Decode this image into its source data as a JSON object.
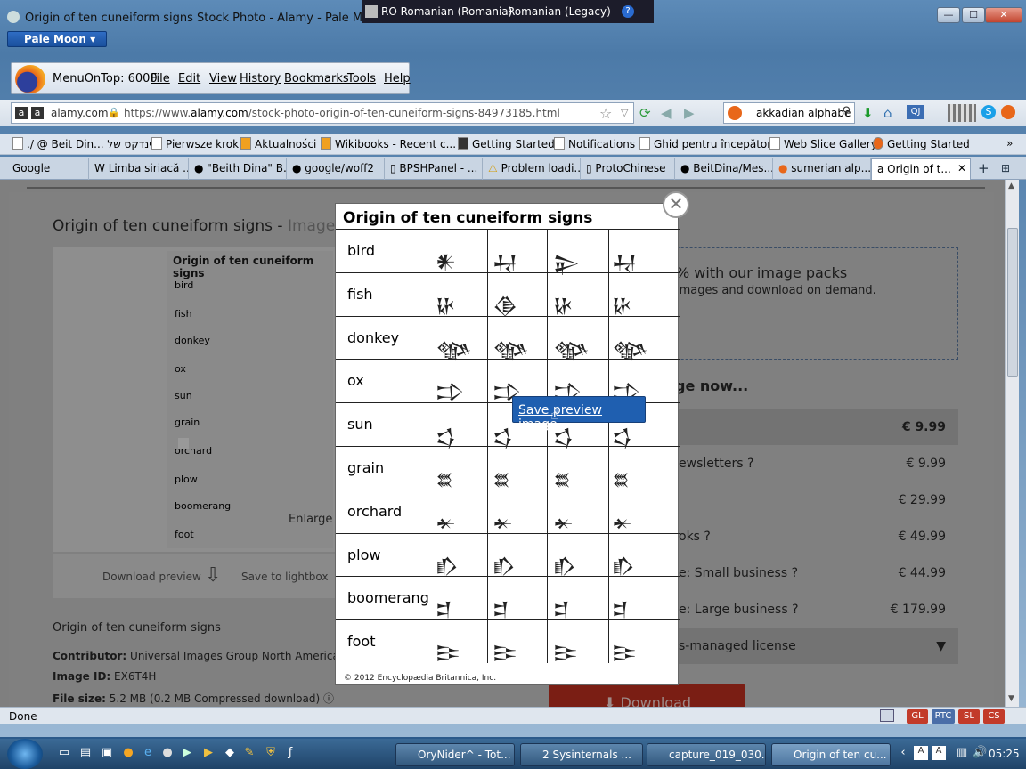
{
  "window": {
    "title": "Origin of ten cuneiform signs Stock Photo - Alamy - Pale Moon",
    "app_button": "Pale Moon",
    "min_glyph": "—",
    "max_glyph": "☐",
    "close_glyph": "✕"
  },
  "language_bar": {
    "input_lang": "RO Romanian (Romania)",
    "keyboard": "Romanian (Legacy)",
    "help_glyph": "?"
  },
  "menubar": {
    "menuontop": "MenuOnTop: 6000",
    "items": [
      "File",
      "Edit",
      "View",
      "History",
      "Bookmarks",
      "Tools",
      "Help"
    ]
  },
  "navbar": {
    "site_label": "alamy.com",
    "url_prefix": "https://www.",
    "url_domain": "alamy.com",
    "url_path": "/stock-photo-origin-of-ten-cuneiform-signs-84973185.html",
    "search_value": "akkadian alphabe"
  },
  "bookmarks": [
    "./ @ Beit Din... אינדקס של",
    "Pierwsze kroki",
    "Aktualności",
    "Wikibooks - Recent c...",
    "Getting Started",
    "Notifications",
    "Ghid pentru începători",
    "Web Slice Gallery",
    "Getting Started"
  ],
  "tabs": [
    "Google",
    "Limba siriacă ...",
    "\"Beith Dina\" B...",
    "google/woff2",
    "BPSHPanel - ...",
    "Problem loadi...",
    "ProtoChinese",
    "BeitDina/Mes...",
    "sumerian alp...",
    "Origin of t..."
  ],
  "page": {
    "heading": "Origin of ten cuneiform signs - ",
    "heading_id": "Image ID:",
    "thumb_title": "Origin of ten cuneiform signs",
    "thumb_rows": [
      "bird",
      "fish",
      "donkey",
      "ox",
      "sun",
      "grain",
      "orchard",
      "plow",
      "boomerang",
      "foot"
    ],
    "enlarge": "Enlarge",
    "download_preview": "Download preview",
    "save_lightbox": "Save to lightbox",
    "caption": "Origin of ten cuneiform signs",
    "contributor_label": "Contributor:",
    "contributor": "Universal Images Group North America LLC /",
    "image_id_label": "Image ID:",
    "image_id": "EX6T4H",
    "filesize_label": "File size:",
    "filesize": "5.2 MB (0.2 MB Compressed download)",
    "pack_title": "% with our image packs",
    "pack_sub": "images and download on demand.",
    "buy_heading": "ge now...",
    "prices": [
      {
        "name": "",
        "price": "€ 9.99"
      },
      {
        "name": "ewsletters",
        "price": "€ 9.99"
      },
      {
        "name": "",
        "price": "€ 29.99"
      },
      {
        "name": "oks",
        "price": "€ 49.99"
      },
      {
        "name": "e: Small business",
        "price": "€ 44.99"
      },
      {
        "name": "e: Large business",
        "price": "€ 179.99"
      }
    ],
    "managed": "s-managed license",
    "download_btn": "⬇ Download"
  },
  "modal": {
    "title": "Origin of ten cuneiform signs",
    "rows": [
      {
        "label": "bird",
        "g": [
          "𒀭",
          "𒄷",
          "𒉌",
          "𒄷"
        ]
      },
      {
        "label": "fish",
        "g": [
          "𒄩",
          "𒆠",
          "𒄩",
          "𒄩"
        ]
      },
      {
        "label": "donkey",
        "g": [
          "𒀲",
          "𒀲",
          "𒀲",
          "𒀲"
        ]
      },
      {
        "label": "ox",
        "g": [
          "𒄞",
          "𒄞",
          "𒄞",
          "𒄞"
        ]
      },
      {
        "label": "sun",
        "g": [
          "𒌓",
          "𒌓",
          "𒌓",
          "𒌓"
        ]
      },
      {
        "label": "grain",
        "g": [
          "𒊺",
          "𒊺",
          "𒊺",
          "𒊺"
        ]
      },
      {
        "label": "orchard",
        "g": [
          "𒄬",
          "𒄬",
          "𒄬",
          "𒄬"
        ]
      },
      {
        "label": "plow",
        "g": [
          "𒁓",
          "𒁓",
          "𒁓",
          "𒁓"
        ]
      },
      {
        "label": "boomerang",
        "g": [
          "𒄑",
          "𒄑",
          "𒄑",
          "𒄑"
        ]
      },
      {
        "label": "foot",
        "g": [
          "𒄿",
          "𒄿",
          "𒄿",
          "𒄿"
        ]
      }
    ],
    "copyright": "© 2012 Encyclopædia Britannica, Inc.",
    "close_glyph": "✕",
    "context_item": "Save preview image"
  },
  "status": {
    "text": "Done",
    "badges": [
      "GL",
      "RTC",
      "SL",
      "CS"
    ]
  },
  "taskbar": {
    "tasks": [
      "OryNider^ - Tot...",
      "2 Sysinternals ...",
      "capture_019_030...",
      "Origin of ten cu..."
    ],
    "clock": "05:25"
  },
  "colors": {
    "accent": "#1f5fb0",
    "download": "#7a1e14",
    "overlay": "#7f7f7f"
  }
}
